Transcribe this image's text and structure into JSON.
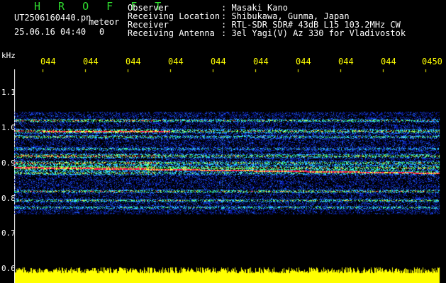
{
  "header": {
    "title": "H R O F F T",
    "filename": "UT2506160440.pn",
    "meteor_label": "meteor",
    "datetime": "25.06.16 04:40",
    "count": "0"
  },
  "info": [
    {
      "label": "Observer",
      "value": ": Masaki Kano"
    },
    {
      "label": "Receiving Location",
      "value": ": Shibukawa, Gunma, Japan"
    },
    {
      "label": "Receiver",
      "value": ": RTL-SDR SDR# 43dB L15 103.2MHz CW"
    },
    {
      "label": "Receiving Antenna",
      "value": ": 3el Yagi(V) Az 330 for Vladivostok"
    }
  ],
  "axis": {
    "unit": "kHz",
    "y_labels": [
      "1.1",
      "1.0",
      "0.9",
      "0.8",
      "0.7",
      "0.6"
    ],
    "x_labels": [
      "044",
      "044",
      "044",
      "044",
      "044",
      "044",
      "044",
      "044",
      "044",
      "0450"
    ]
  },
  "colors": {
    "background": "#000000",
    "header_title": "#2fdc2f",
    "text": "#ffffff",
    "time_label": "#ffff00",
    "spectrum": "#ffff00"
  }
}
